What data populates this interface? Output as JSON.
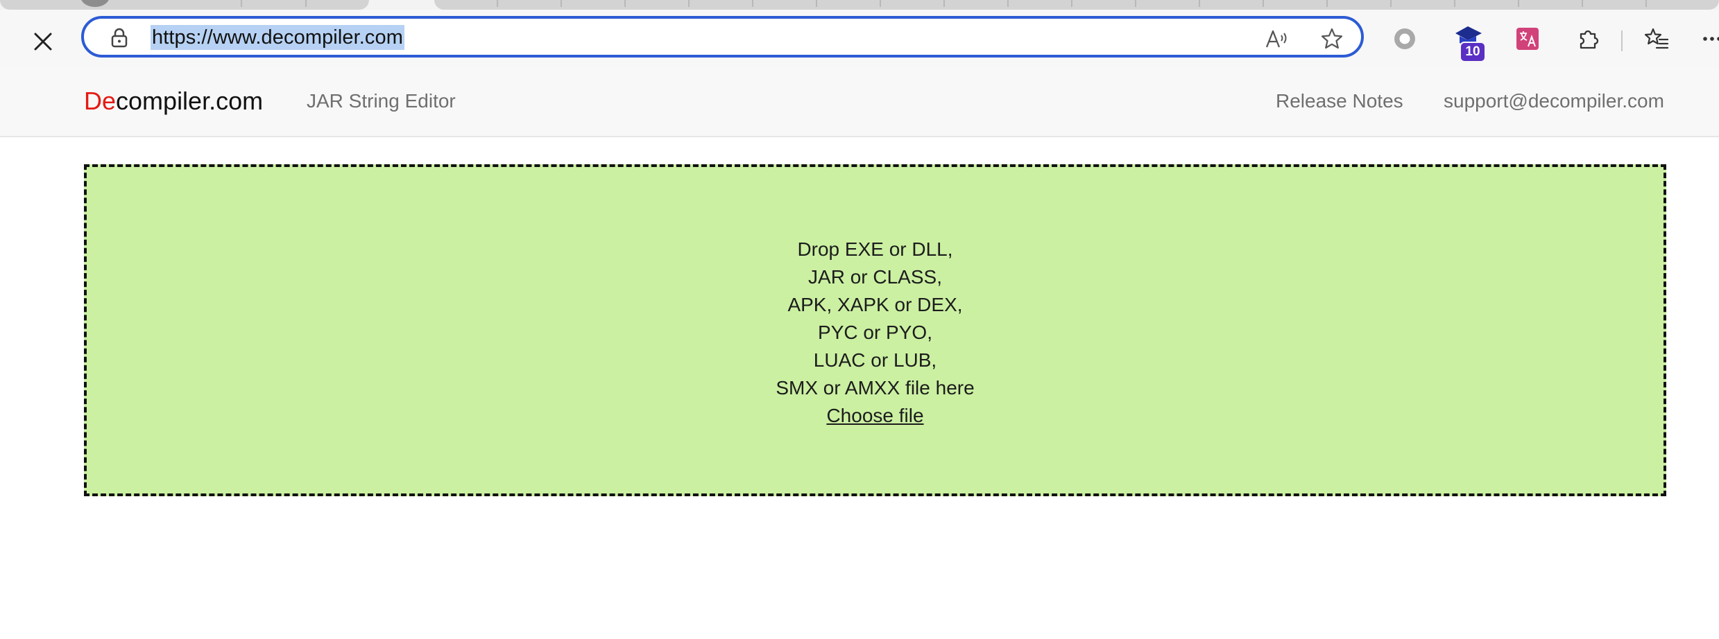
{
  "browser": {
    "url": "https://www.decompiler.com",
    "extension_badge": "10",
    "icons": {
      "close": "close-icon",
      "lock": "lock-icon",
      "read_aloud": "read-aloud-icon",
      "favorite": "star-icon",
      "ext1": "record-icon",
      "ext2": "graduation-cap-icon",
      "ext3": "translate-icon",
      "extensions": "puzzle-icon",
      "favorites_list": "favorites-list-icon",
      "more": "more-icon"
    },
    "colors": {
      "address_border": "#2c5bd4",
      "selection": "#b6d1f3",
      "badge": "#5a2fc4"
    }
  },
  "site": {
    "brand_accent": "De",
    "brand_rest": "compiler.com",
    "nav": {
      "jar_string_editor": "JAR String Editor",
      "release_notes": "Release Notes",
      "support_email": "support@decompiler.com"
    },
    "colors": {
      "brand_accent": "#e41b13",
      "dropzone_bg": "#cbf0a2"
    }
  },
  "dropzone": {
    "lines": [
      "Drop EXE or DLL,",
      "JAR or CLASS,",
      "APK, XAPK or DEX,",
      "PYC or PYO,",
      "LUAC or LUB,",
      "SMX or AMXX file here"
    ],
    "choose_file": "Choose file"
  }
}
